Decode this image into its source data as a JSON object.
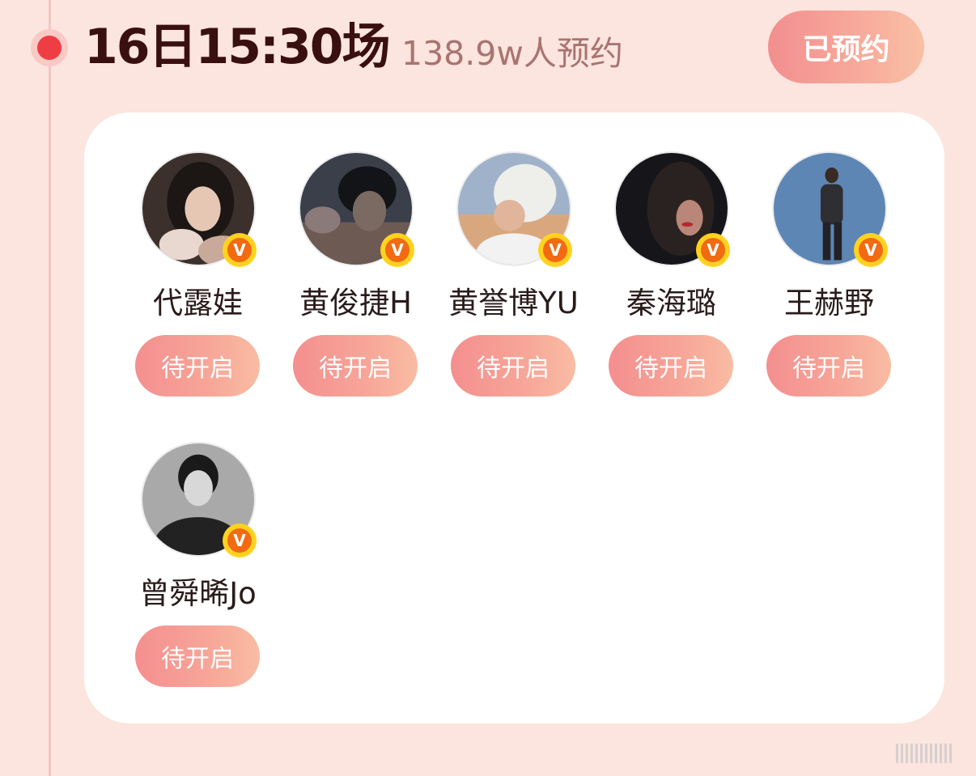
{
  "session": {
    "title": "16日15:30场",
    "reserve_count": "138.9w人预约",
    "reserved_label": "已预约"
  },
  "colors": {
    "page_bg": "#fbe5de",
    "accent_red": "#ee3e44",
    "button_gradient_start": "#f28f8f",
    "button_gradient_end": "#f9c0a5",
    "verified_badge": "#ffd21f"
  },
  "stars": [
    {
      "name": "代露娃",
      "button": "待开启",
      "verified": true
    },
    {
      "name": "黄俊捷H",
      "button": "待开启",
      "verified": true
    },
    {
      "name": "黄誉博YU",
      "button": "待开启",
      "verified": true
    },
    {
      "name": "秦海璐",
      "button": "待开启",
      "verified": true
    },
    {
      "name": "王赫野",
      "button": "待开启",
      "verified": true
    },
    {
      "name": "曾舜晞Jo",
      "button": "待开启",
      "verified": true
    }
  ],
  "badge": {
    "letter": "V"
  }
}
